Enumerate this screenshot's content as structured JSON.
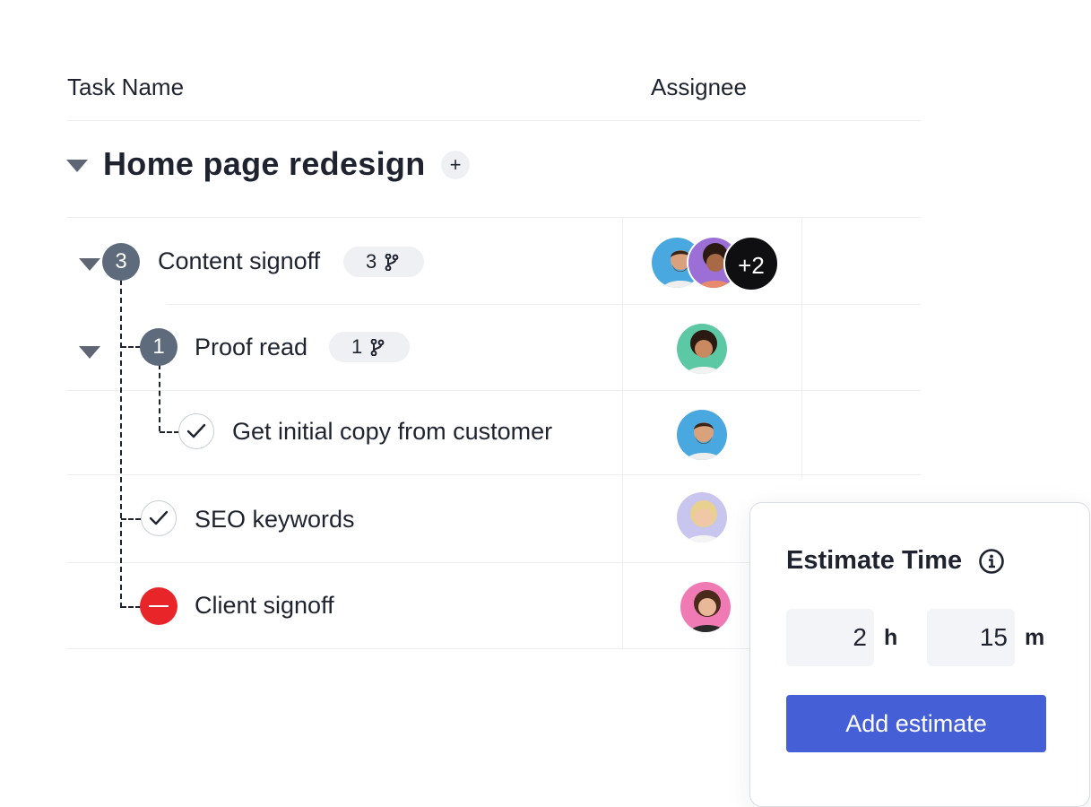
{
  "header": {
    "task_name": "Task Name",
    "assignee": "Assignee"
  },
  "group": {
    "title": "Home page redesign",
    "add_symbol": "+"
  },
  "tasks": [
    {
      "name": "Content signoff",
      "status_number": "3",
      "subtask_count": "3",
      "extra_assignees": "+2"
    },
    {
      "name": "Proof read",
      "status_number": "1",
      "subtask_count": "1"
    },
    {
      "name": "Get initial copy from customer",
      "status": "done"
    },
    {
      "name": "SEO keywords",
      "status": "done"
    },
    {
      "name": "Client signoff",
      "status": "blocked"
    }
  ],
  "estimate_popup": {
    "title": "Estimate Time",
    "hours_value": "2",
    "hours_unit": "h",
    "minutes_value": "15",
    "minutes_unit": "m",
    "button_label": "Add estimate"
  },
  "icons": {
    "caret": "caret-down-icon",
    "subtask": "branch-icon",
    "check": "check-icon",
    "blocked": "minus-circle-icon",
    "info": "info-icon"
  },
  "colors": {
    "accent": "#4560d6",
    "status_number": "#5e6b7c",
    "blocked": "#e8262a",
    "text": "#1f2330"
  }
}
